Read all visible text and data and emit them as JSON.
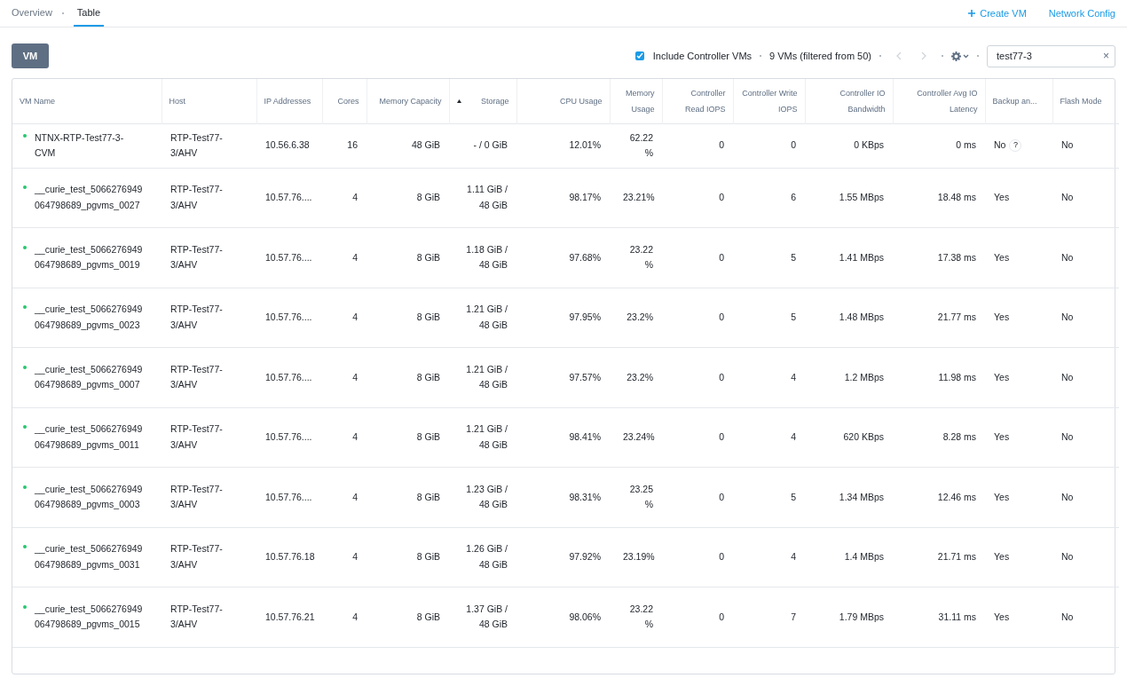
{
  "tabs": [
    {
      "label": "Overview",
      "selected": false
    },
    {
      "label": "Table",
      "selected": true
    }
  ],
  "actions": [
    "Create VM",
    "Network Config"
  ],
  "entity_button": "VM",
  "toolbar": {
    "include_cvms": {
      "label": "Include Controller VMs",
      "checked": true
    },
    "count": "9 VMs (filtered from 50)",
    "prev_disabled": true,
    "next_disabled": true,
    "search": {
      "value": "test77-3",
      "clear": "×"
    }
  },
  "table": {
    "columns": [
      {
        "label": "VM Name",
        "sorted": false
      },
      {
        "label": "Host",
        "sorted": false
      },
      {
        "label": "IP Addresses",
        "sorted": false
      },
      {
        "label": "Cores",
        "sorted": false
      },
      {
        "label": "Memory Capacity",
        "sorted": false
      },
      {
        "label": "Storage",
        "sorted": true
      },
      {
        "label": "CPU Usage",
        "sorted": false
      },
      {
        "label": "Memory Usage",
        "sorted": false
      },
      {
        "label": "Controller Read IOPS",
        "sorted": false
      },
      {
        "label": "Controller Write IOPS",
        "sorted": false
      },
      {
        "label": "Controller IO Bandwidth",
        "sorted": false
      },
      {
        "label": "Controller Avg IO Latency",
        "sorted": false
      },
      {
        "label": "Backup an...",
        "sorted": false
      },
      {
        "label": "Flash Mode",
        "sorted": false
      }
    ],
    "rows": [
      {
        "powered_on": true,
        "cells": [
          "NTNX-RTP-Test77-3-CVM",
          "RTP-Test77-3/AHV",
          "10.56.6.38",
          "16",
          "48 GiB",
          "- / 0 GiB",
          "12.01%",
          "62.22 %",
          "0",
          "0",
          "0 KBps",
          "0 ms",
          "No",
          "No"
        ],
        "backup_help": "?"
      },
      {
        "powered_on": true,
        "cells": [
          "__curie_test_5066276949064798689_pgvms_0027",
          "RTP-Test77-3/AHV",
          "10.57.76....",
          "4",
          "8 GiB",
          "1.11 GiB / 48 GiB",
          "98.17%",
          "23.21%",
          "0",
          "6",
          "1.55 MBps",
          "18.48 ms",
          "Yes",
          "No"
        ]
      },
      {
        "powered_on": true,
        "cells": [
          "__curie_test_5066276949064798689_pgvms_0019",
          "RTP-Test77-3/AHV",
          "10.57.76....",
          "4",
          "8 GiB",
          "1.18 GiB / 48 GiB",
          "97.68%",
          "23.22 %",
          "0",
          "5",
          "1.41 MBps",
          "17.38 ms",
          "Yes",
          "No"
        ]
      },
      {
        "powered_on": true,
        "cells": [
          "__curie_test_5066276949064798689_pgvms_0023",
          "RTP-Test77-3/AHV",
          "10.57.76....",
          "4",
          "8 GiB",
          "1.21 GiB / 48 GiB",
          "97.95%",
          "23.2%",
          "0",
          "5",
          "1.48 MBps",
          "21.77 ms",
          "Yes",
          "No"
        ]
      },
      {
        "powered_on": true,
        "cells": [
          "__curie_test_5066276949064798689_pgvms_0007",
          "RTP-Test77-3/AHV",
          "10.57.76....",
          "4",
          "8 GiB",
          "1.21 GiB / 48 GiB",
          "97.57%",
          "23.2%",
          "0",
          "4",
          "1.2 MBps",
          "11.98 ms",
          "Yes",
          "No"
        ]
      },
      {
        "powered_on": true,
        "cells": [
          "__curie_test_5066276949064798689_pgvms_0011",
          "RTP-Test77-3/AHV",
          "10.57.76....",
          "4",
          "8 GiB",
          "1.21 GiB / 48 GiB",
          "98.41%",
          "23.24%",
          "0",
          "4",
          "620 KBps",
          "8.28 ms",
          "Yes",
          "No"
        ]
      },
      {
        "powered_on": true,
        "cells": [
          "__curie_test_5066276949064798689_pgvms_0003",
          "RTP-Test77-3/AHV",
          "10.57.76....",
          "4",
          "8 GiB",
          "1.23 GiB / 48 GiB",
          "98.31%",
          "23.25 %",
          "0",
          "5",
          "1.34 MBps",
          "12.46 ms",
          "Yes",
          "No"
        ]
      },
      {
        "powered_on": true,
        "cells": [
          "__curie_test_5066276949064798689_pgvms_0031",
          "RTP-Test77-3/AHV",
          "10.57.76.18",
          "4",
          "8 GiB",
          "1.26 GiB / 48 GiB",
          "97.92%",
          "23.19%",
          "0",
          "4",
          "1.4 MBps",
          "21.71 ms",
          "Yes",
          "No"
        ]
      },
      {
        "powered_on": true,
        "cells": [
          "__curie_test_5066276949064798689_pgvms_0015",
          "RTP-Test77-3/AHV",
          "10.57.76.21",
          "4",
          "8 GiB",
          "1.37 GiB / 48 GiB",
          "98.06%",
          "23.22 %",
          "0",
          "7",
          "1.79 MBps",
          "31.11 ms",
          "Yes",
          "No"
        ]
      }
    ]
  }
}
